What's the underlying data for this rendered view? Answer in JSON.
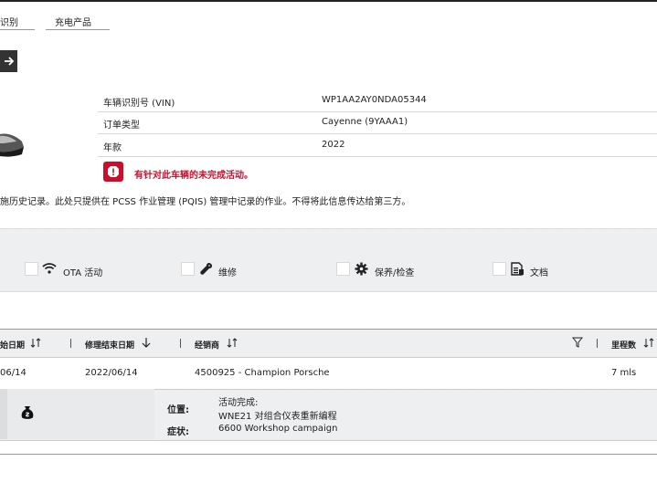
{
  "tabs": [
    {
      "label": "识别"
    },
    {
      "label": "充电产品"
    }
  ],
  "vehicle_info": {
    "rows": [
      {
        "label": "车辆识别号 (VIN)",
        "value": "WP1AA2AY0NDA05344"
      },
      {
        "label": "订单类型",
        "value": "Cayenne (9YAAA1)"
      },
      {
        "label": "年款",
        "value": "2022"
      }
    ],
    "alert": "有针对此车辆的未完成活动。"
  },
  "notice": "施历史记录。此处只提供在 PCSS 作业管理 (PQIS) 管理中记录的作业。不得将此信息传达给第三方。",
  "filters": [
    {
      "label": "OTA 活动",
      "icon": "wifi-icon"
    },
    {
      "label": "维修",
      "icon": "wrench-icon"
    },
    {
      "label": "保养/检查",
      "icon": "gear-icon"
    },
    {
      "label": "文档",
      "icon": "document-icon"
    }
  ],
  "table": {
    "headers": {
      "start_date": "始日期",
      "end_date": "修理结束日期",
      "dealer": "经销商",
      "mileage": "里程数"
    },
    "rows": [
      {
        "start_date": "06/14",
        "end_date": "2022/06/14",
        "dealer": "4500925 - Champion Porsche",
        "mileage": "7 mls"
      }
    ],
    "detail": {
      "location_label": "位置:",
      "symptom_label": "症状:",
      "activity_label": "活动完成:",
      "activity_value": "WNE21 对组合仪表重新编程",
      "symptom_value": "6600 Workshop campaign"
    }
  },
  "colors": {
    "alert": "#c8102e",
    "bar_bg": "#eeeff1"
  }
}
